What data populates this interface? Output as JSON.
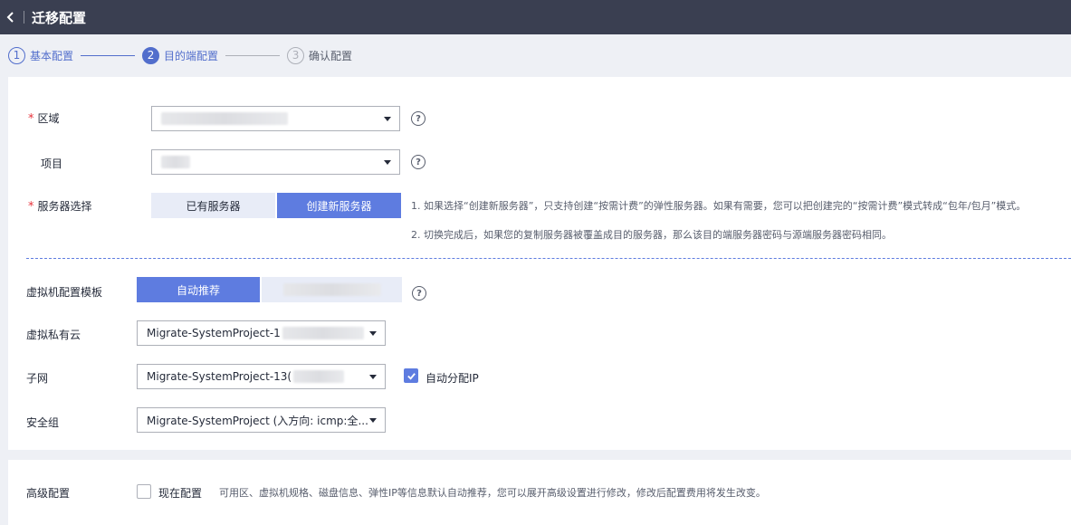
{
  "header": {
    "title": "迁移配置"
  },
  "steps": [
    {
      "num": "1",
      "label": "基本配置"
    },
    {
      "num": "2",
      "label": "目的端配置"
    },
    {
      "num": "3",
      "label": "确认配置"
    }
  ],
  "form": {
    "region": {
      "label": "区域",
      "required": "*",
      "help": "?"
    },
    "project": {
      "label": "项目",
      "help": "?"
    },
    "server_select": {
      "label": "服务器选择",
      "required": "*",
      "options": [
        "已有服务器",
        "创建新服务器"
      ],
      "selected": "创建新服务器",
      "notes": [
        "1. 如果选择“创建新服务器”，只支持创建“按需计费”的弹性服务器。如果有需要，您可以把创建完的“按需计费”模式转成“包年/包月”模式。",
        "2. 切换完成后，如果您的复制服务器被覆盖成目的服务器，那么该目的端服务器密码与源端服务器密码相同。"
      ]
    },
    "vm_template": {
      "label": "虚拟机配置模板",
      "options": [
        "自动推荐"
      ],
      "selected": "自动推荐",
      "help": "?"
    },
    "vpc": {
      "label": "虚拟私有云",
      "value": "Migrate-SystemProject-1"
    },
    "subnet": {
      "label": "子网",
      "value": "Migrate-SystemProject-13(",
      "auto_ip_label": "自动分配IP",
      "auto_ip_checked": true
    },
    "security_group": {
      "label": "安全组",
      "value": "Migrate-SystemProject (入方向: icmp:全..."
    }
  },
  "advanced": {
    "label": "高级配置",
    "checkbox_label": "现在配置",
    "checked": false,
    "hint": "可用区、虚拟机规格、磁盘信息、弹性IP等信息默认自动推荐，您可以展开高级设置进行修改，修改后配置费用将发生改变。"
  },
  "colors": {
    "accent": "#5e7ce0",
    "header_bg": "#3a3f51",
    "required": "#e7323a"
  }
}
